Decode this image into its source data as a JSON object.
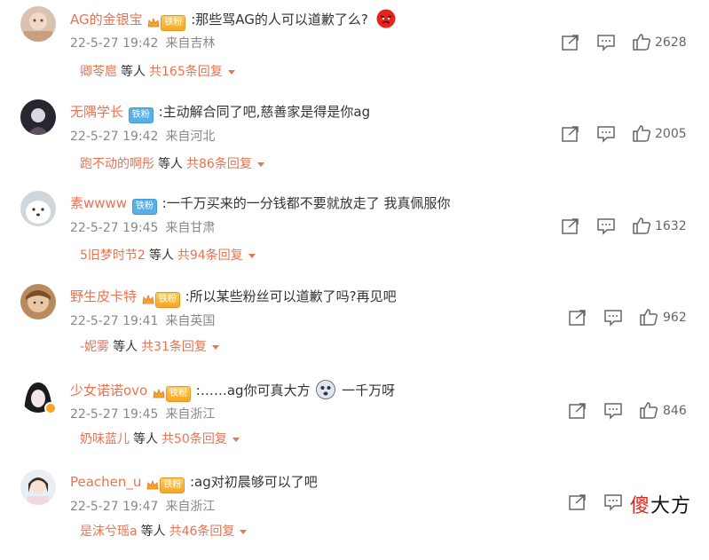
{
  "comments": [
    {
      "username": "AG的金银宝",
      "badge": "铁粉",
      "badge_style": "gold",
      "text": ":那些骂AG的人可以道歉了么?",
      "emoji": "angry-face-icon",
      "date": "22-5-27 19:42",
      "location": "来自吉林",
      "likes": "2628",
      "reply_user": "卿苓扈",
      "reply_mid": "等人",
      "reply_total": "共165条回复",
      "verified": false
    },
    {
      "username": "无隅学长",
      "badge": "铁粉",
      "badge_style": "blue",
      "text": ":主动解合同了吧,慈善家是得是你ag",
      "emoji": "",
      "date": "22-5-27 19:42",
      "location": "来自河北",
      "likes": "2005",
      "reply_user": "跑不动的啊彤",
      "reply_mid": "等人",
      "reply_total": "共86条回复",
      "verified": false
    },
    {
      "username": "素wwww",
      "badge": "铁粉",
      "badge_style": "blue",
      "text": ":一千万买来的一分钱都不要就放走了 我真佩服你",
      "emoji": "",
      "date": "22-5-27 19:45",
      "location": "来自甘肃",
      "likes": "1632",
      "reply_user": "5旧梦时节2",
      "reply_mid": "等人",
      "reply_total": "共94条回复",
      "verified": false
    },
    {
      "username": "野生皮卡特",
      "badge": "铁粉",
      "badge_style": "gold",
      "text": ":所以某些粉丝可以道歉了吗?再见吧",
      "emoji": "",
      "date": "22-5-27 19:41",
      "location": "来自英国",
      "likes": "962",
      "reply_user": "-妮雾",
      "reply_mid": "等人",
      "reply_total": "共31条回复",
      "verified": false
    },
    {
      "username": "少女诺诺ovo",
      "badge": "铁粉",
      "badge_style": "gold",
      "text": ":……ag你可真大方",
      "text2": "一千万呀",
      "emoji": "",
      "date": "22-5-27 19:45",
      "location": "来自浙江",
      "likes": "846",
      "reply_user": "奶味蓝儿",
      "reply_mid": "等人",
      "reply_total": "共50条回复",
      "verified": true
    },
    {
      "username": "Peachen_u",
      "badge": "铁粉",
      "badge_style": "gold",
      "text": ":ag对初晨够可以了吧",
      "emoji": "",
      "date": "22-5-27 19:47",
      "location": "来自浙江",
      "likes": "",
      "reply_user": "是沫兮瑶a",
      "reply_mid": "等人",
      "reply_total": "共46条回复",
      "verified": false
    }
  ],
  "watermark": {
    "part1": "傻",
    "part2": "大方"
  },
  "colors": {
    "accent": "#eb7350",
    "badge_gold": "#f5a623",
    "badge_blue": "#5ab0e6",
    "meta": "#888888"
  }
}
